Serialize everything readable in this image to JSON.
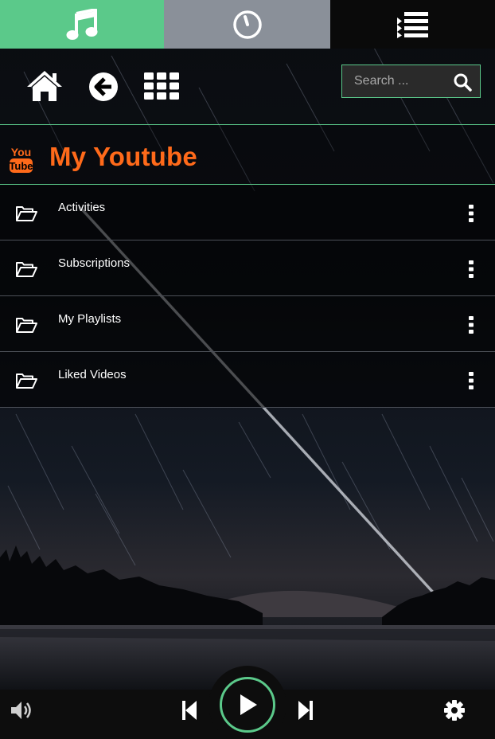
{
  "tabs": {
    "music": {
      "icon": "music-note-icon",
      "color": "#5bc98a"
    },
    "timer": {
      "icon": "timer-icon",
      "color": "#8a9099"
    },
    "queue": {
      "icon": "playlist-queue-icon",
      "color": "#0a0a0a"
    }
  },
  "nav": {
    "icons": [
      "home-icon",
      "back-arrow-icon",
      "grid-apps-icon"
    ],
    "search": {
      "placeholder": "Search ...",
      "value": "",
      "icon": "search-icon"
    }
  },
  "header": {
    "logo_top": "You",
    "logo_bottom": "Tube",
    "title": "My Youtube",
    "title_color": "#ff6a1a"
  },
  "list": {
    "items": [
      {
        "label": "Activities",
        "icon": "folder-open-icon"
      },
      {
        "label": "Subscriptions",
        "icon": "folder-open-icon"
      },
      {
        "label": "My Playlists",
        "icon": "folder-open-icon"
      },
      {
        "label": "Liked Videos",
        "icon": "folder-open-icon"
      }
    ]
  },
  "player": {
    "icons": [
      "volume-icon",
      "previous-track-icon",
      "play-icon",
      "next-track-icon",
      "settings-gear-icon"
    ],
    "accent": "#5bc98a"
  }
}
